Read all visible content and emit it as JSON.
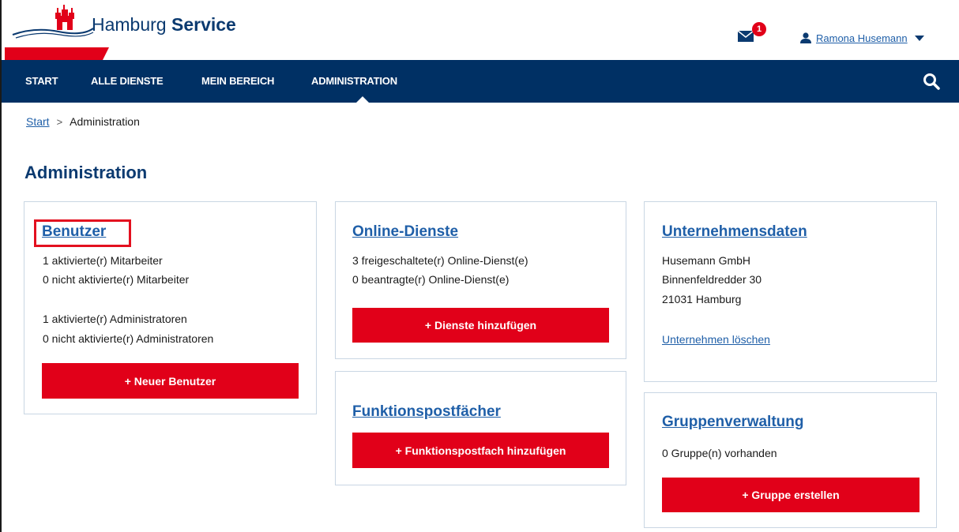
{
  "header": {
    "logo_text_regular": "Hamburg",
    "logo_text_bold": "Service",
    "mail_badge": "1",
    "user_name": "Ramona Husemann"
  },
  "nav": {
    "items": [
      {
        "label": "START"
      },
      {
        "label": "ALLE DIENSTE"
      },
      {
        "label": "MEIN BEREICH"
      },
      {
        "label": "ADMINISTRATION",
        "active": true
      }
    ]
  },
  "breadcrumb": {
    "home": "Start",
    "separator": ">",
    "current": "Administration"
  },
  "page_title": "Administration",
  "cards": {
    "benutzer": {
      "title": "Benutzer",
      "lines": [
        "1 aktivierte(r) Mitarbeiter",
        "0 nicht aktivierte(r) Mitarbeiter",
        "1 aktivierte(r) Administratoren",
        "0 nicht aktivierte(r) Administratoren"
      ],
      "button": "+ Neuer Benutzer"
    },
    "online_dienste": {
      "title": "Online-Dienste",
      "lines": [
        "3 freigeschaltete(r) Online-Dienst(e)",
        "0 beantragte(r) Online-Dienst(e)"
      ],
      "button": "+ Dienste hinzufügen"
    },
    "funktionspostfaecher": {
      "title": "Funktionspostfächer",
      "button": "+ Funktionspostfach hinzufügen"
    },
    "unternehmensdaten": {
      "title": "Unternehmensdaten",
      "lines": [
        "Husemann GmbH",
        "Binnenfeldredder 30",
        "21031 Hamburg"
      ],
      "link": "Unternehmen löschen"
    },
    "gruppenverwaltung": {
      "title": "Gruppenverwaltung",
      "lines": [
        "0 Gruppe(n) vorhanden"
      ],
      "button": "+ Gruppe erstellen"
    }
  },
  "colors": {
    "nav_bg": "#003064",
    "accent_red": "#e10019",
    "link_blue": "#1f5fa8",
    "title_blue": "#0b3a70"
  },
  "icons": {
    "logo": "hamburg-castle-icon",
    "mail": "mail-icon",
    "user": "user-icon",
    "caret": "caret-down-icon",
    "search": "search-icon"
  }
}
